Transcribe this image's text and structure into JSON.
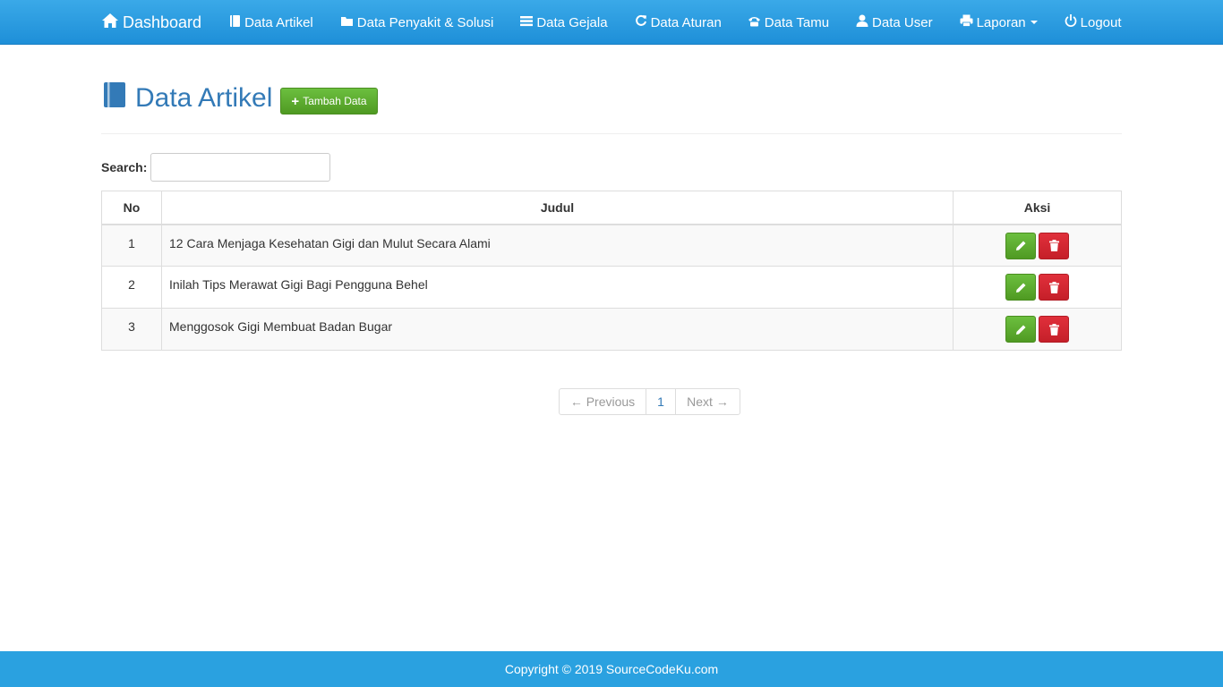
{
  "navbar": {
    "brand": "Dashboard",
    "items": [
      {
        "label": "Data Artikel",
        "icon": "book-icon"
      },
      {
        "label": "Data Penyakit & Solusi",
        "icon": "folder-icon"
      },
      {
        "label": "Data Gejala",
        "icon": "list-icon"
      },
      {
        "label": "Data Aturan",
        "icon": "refresh-icon"
      },
      {
        "label": "Data Tamu",
        "icon": "phone-icon"
      },
      {
        "label": "Data User",
        "icon": "user-icon"
      },
      {
        "label": "Laporan",
        "icon": "print-icon"
      },
      {
        "label": "Logout",
        "icon": "power-icon"
      }
    ]
  },
  "page": {
    "title": "Data Artikel",
    "add_button": "Tambah Data"
  },
  "search": {
    "label": "Search:",
    "value": ""
  },
  "table": {
    "headers": [
      "No",
      "Judul",
      "Aksi"
    ],
    "rows": [
      {
        "no": "1",
        "judul": "12 Cara Menjaga Kesehatan Gigi dan Mulut Secara Alami"
      },
      {
        "no": "2",
        "judul": "Inilah Tips Merawat Gigi Bagi Pengguna Behel"
      },
      {
        "no": "3",
        "judul": "Menggosok Gigi Membuat Badan Bugar"
      }
    ]
  },
  "pagination": {
    "previous": "← Previous",
    "current": "1",
    "next": "Next →"
  },
  "footer": {
    "text": "Copyright © 2019 SourceCodeKu.com"
  },
  "colors": {
    "navbar": "#1e8fd8",
    "title": "#337ab7",
    "success": "#5cb85c",
    "danger": "#d9303a",
    "footer": "#2aa1e0"
  }
}
